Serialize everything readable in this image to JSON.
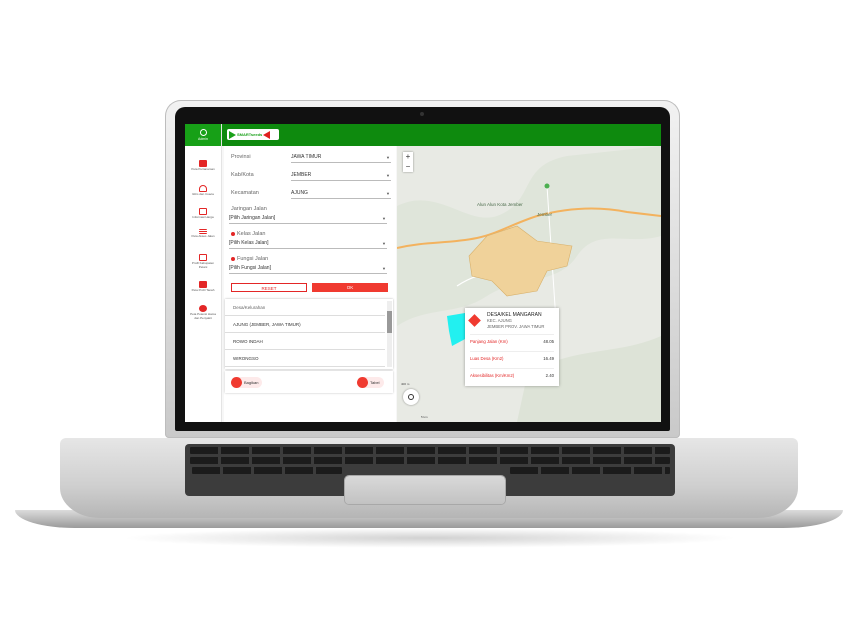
{
  "app": {
    "logo_text": "SMARTseeds",
    "admin_label": "Admin"
  },
  "sidebar": {
    "items": [
      {
        "label": "Peta Pertanaman",
        "icon": "map-icon"
      },
      {
        "label": "Iklim dan Cuaca",
        "icon": "cloud-icon"
      },
      {
        "label": "Informasi Harga",
        "icon": "price-tag-icon"
      },
      {
        "label": "Peta Akses Jalan",
        "icon": "road-icon"
      },
      {
        "label": "Profil Kabupaten Petani",
        "icon": "home-icon"
      },
      {
        "label": "Peta Profil Tanah",
        "icon": "layers-icon"
      },
      {
        "label": "Peta Potensi Hama dan Penyakit",
        "icon": "bug-icon"
      }
    ]
  },
  "filters": {
    "provinsi_label": "Provinsi",
    "provinsi_value": "JAWA TIMUR",
    "kabkota_label": "Kab/Kota",
    "kabkota_value": "JEMBER",
    "kecamatan_label": "Kecamatan",
    "kecamatan_value": "AJUNG",
    "jaringan_label": "Jaringan Jalan",
    "jaringan_value": "[Pilih Jaringan Jalan]",
    "kelas_label": "Kelas Jalan",
    "kelas_value": "[Pilih Kelas Jalan]",
    "fungsi_label": "Fungsi Jalan",
    "fungsi_value": "[Pilih Fungsi Jalan]",
    "reset_label": "RESET",
    "ok_label": "OK"
  },
  "list": {
    "header": "Desa/Kelurahan",
    "items": [
      "AJUNG (JEMBER, JAWA TIMUR)",
      "ROWO INDAH",
      "WIRONGSO"
    ]
  },
  "bottom": {
    "bagikan_label": "Bagikan",
    "tabel_label": "Tabel"
  },
  "map": {
    "alun_label": "Alun Alun Kota Jember",
    "jember_label": "Jember",
    "scale_top": "400 m",
    "scale_bottom": "5 km"
  },
  "info": {
    "title": "DESA/KEL MANGARAN",
    "kec": "KEC. AJUNG",
    "location": "JEMBER PROV. JAWA TIMUR",
    "rows": [
      {
        "key": "Panjang Jalan (Km)",
        "value": "48.05"
      },
      {
        "key": "Luas Desa (Km2)",
        "value": "16.49"
      },
      {
        "key": "Aksesibilitas (Km/Km2)",
        "value": "2.40"
      }
    ]
  },
  "colors": {
    "topbar": "#0e8a0e",
    "accent": "#f03a30",
    "region_fill": "#f0d29a",
    "selected_fill": "#22f0f0"
  }
}
